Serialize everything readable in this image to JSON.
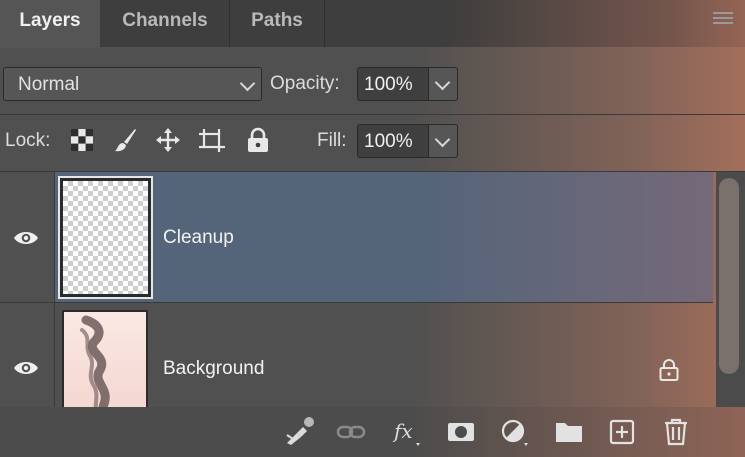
{
  "tabs": [
    {
      "label": "Layers",
      "active": true
    },
    {
      "label": "Channels",
      "active": false
    },
    {
      "label": "Paths",
      "active": false
    }
  ],
  "blend_mode": {
    "value": "Normal"
  },
  "opacity": {
    "label": "Opacity:",
    "value": "100%"
  },
  "lock": {
    "label": "Lock:",
    "icons": [
      "lock-transparent-pixels-icon",
      "lock-image-pixels-icon",
      "lock-position-icon",
      "lock-artboard-icon",
      "lock-all-icon"
    ]
  },
  "fill": {
    "label": "Fill:",
    "value": "100%"
  },
  "layers": [
    {
      "name": "Cleanup",
      "visible": true,
      "selected": true,
      "locked": false
    },
    {
      "name": "Background",
      "visible": true,
      "selected": false,
      "locked": true
    }
  ],
  "toolbar_icons": [
    "generative-fill-icon",
    "link-layers-icon",
    "fx-icon",
    "add-mask-icon",
    "adjustment-layer-icon",
    "new-group-icon",
    "new-layer-icon",
    "delete-layer-icon"
  ],
  "colors": {
    "selection": "#546479",
    "panel": "#505050",
    "accent_gradient": "#b2745c"
  }
}
